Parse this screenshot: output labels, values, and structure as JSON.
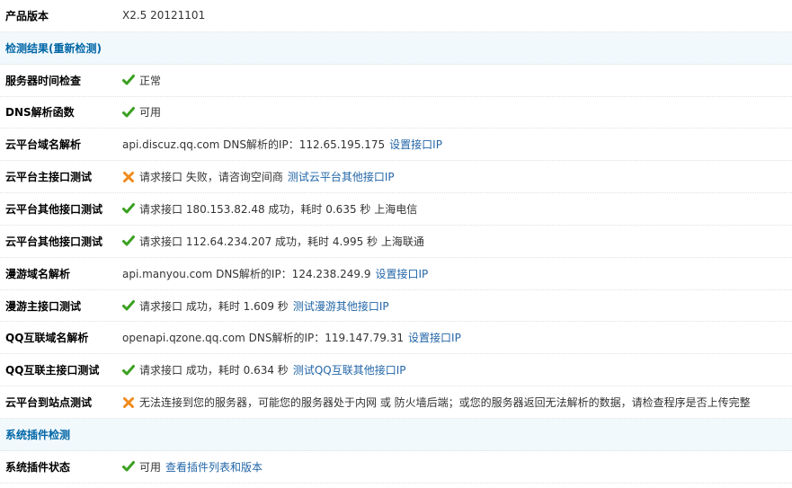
{
  "colors": {
    "ok": "#3aa020",
    "error": "#f08a1c",
    "link": "#2366a8",
    "header_bg": "#f2f9fd",
    "section_title": "#0066a6"
  },
  "product": {
    "label": "产品版本",
    "value": "X2.5 20121101"
  },
  "section1": {
    "title": "检测结果(",
    "link": "重新检测",
    "close": ")"
  },
  "rows": [
    {
      "label": "服务器时间检查",
      "icon": "check-icon",
      "text": "正常"
    },
    {
      "label": "DNS解析函数",
      "icon": "check-icon",
      "text": "可用"
    },
    {
      "label": "云平台域名解析",
      "text": "api.discuz.qq.com DNS解析的IP：112.65.195.175",
      "link": "设置接口IP"
    },
    {
      "label": "云平台主接口测试",
      "icon": "cross-icon",
      "text": "请求接口 失败，请咨询空间商",
      "link": "测试云平台其他接口IP"
    },
    {
      "label": "云平台其他接口测试",
      "icon": "check-icon",
      "text": "请求接口 180.153.82.48 成功，耗时 0.635 秒 上海电信"
    },
    {
      "label": "云平台其他接口测试",
      "icon": "check-icon",
      "text": "请求接口 112.64.234.207 成功，耗时 4.995 秒 上海联通"
    },
    {
      "label": "漫游域名解析",
      "text": "api.manyou.com DNS解析的IP：124.238.249.9",
      "link": "设置接口IP"
    },
    {
      "label": "漫游主接口测试",
      "icon": "check-icon",
      "text": "请求接口 成功，耗时 1.609 秒",
      "link": "测试漫游其他接口IP"
    },
    {
      "label": "QQ互联域名解析",
      "text": "openapi.qzone.qq.com DNS解析的IP：119.147.79.31",
      "link": "设置接口IP"
    },
    {
      "label": "QQ互联主接口测试",
      "icon": "check-icon",
      "text": "请求接口 成功，耗时 0.634 秒",
      "link": "测试QQ互联其他接口IP"
    },
    {
      "label": "云平台到站点测试",
      "icon": "cross-icon",
      "text": "无法连接到您的服务器，可能您的服务器处于内网 或 防火墙后端；或您的服务器返回无法解析的数据，请检查程序是否上传完整"
    }
  ],
  "section2": {
    "title": "系统插件检测"
  },
  "plugin": {
    "label": "系统插件状态",
    "icon": "check-icon",
    "text": "可用",
    "link": "查看插件列表和版本"
  }
}
